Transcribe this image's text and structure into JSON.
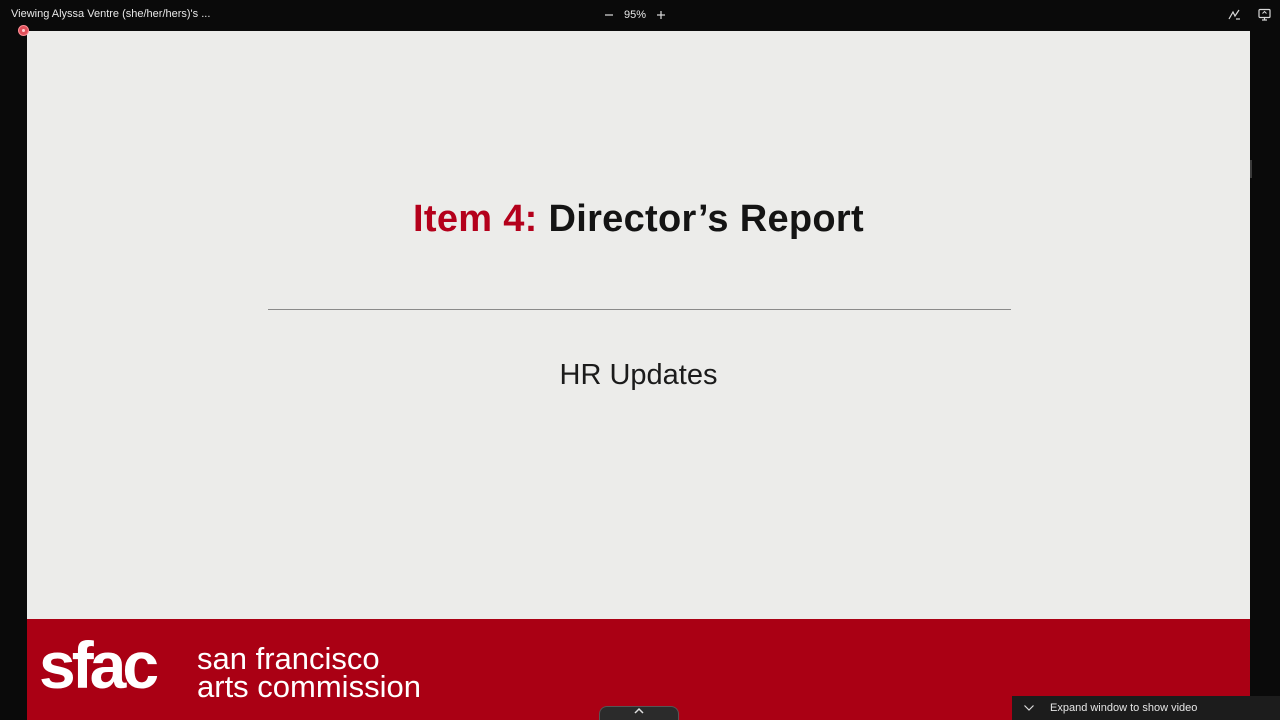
{
  "toolbar": {
    "viewing_label": "Viewing Alyssa Ventre (she/her/hers)'s ...",
    "zoom_level": "95%",
    "zoom_out_icon": "minus-icon",
    "zoom_in_icon": "plus-icon",
    "annotate_icon": "annotate-icon",
    "view_options_icon": "screen-share-icon"
  },
  "slide": {
    "title_prefix": "Item 4:",
    "title_main": "Director’s Report",
    "subtitle": "HR Updates",
    "footer_logo_mark": "sfac",
    "footer_logo_line1": "san francisco",
    "footer_logo_line2": "arts commission"
  },
  "bottom": {
    "expand_label": "Expand window to show video",
    "expand_icon": "chevron-down-icon",
    "handle_icon": "chevron-up-icon"
  },
  "colors": {
    "accent_red": "#b4001b",
    "footer_red": "#aa0014",
    "slide_bg": "#ececea",
    "app_bg": "#0a0a0a"
  }
}
